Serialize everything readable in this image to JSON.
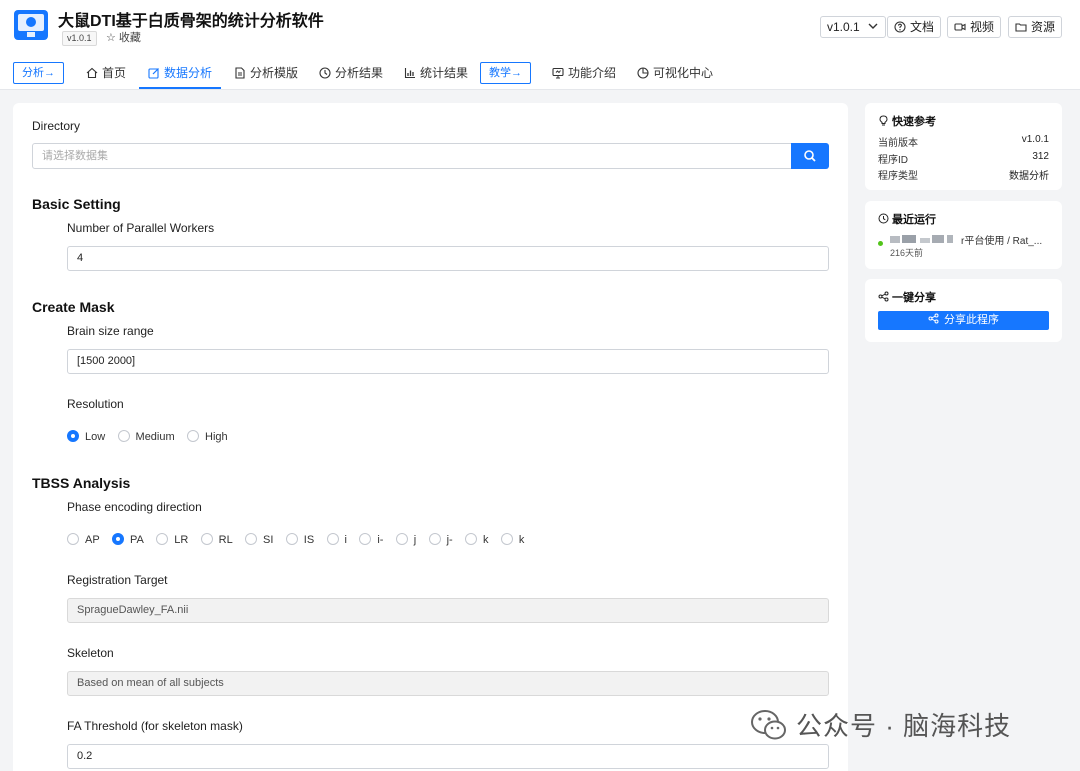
{
  "header": {
    "app_title": "大鼠DTI基于白质骨架的统计分析软件",
    "version_tag": "v1.0.1",
    "favorite_label": "☆ 收藏",
    "version_select": "v1.0.1",
    "docs_label": "文档",
    "video_label": "视频",
    "resources_label": "资源"
  },
  "nav": {
    "analyze_btn": "分析→",
    "home": "首页",
    "data_analysis": "数据分析",
    "analysis_template": "分析模版",
    "analysis_results": "分析结果",
    "stat_results": "统计结果",
    "teaching_btn": "教学→",
    "features": "功能介绍",
    "visual_center": "可视化中心"
  },
  "form": {
    "directory_label": "Directory",
    "directory_placeholder": "请选择数据集",
    "basic_setting_title": "Basic Setting",
    "workers_label": "Number of Parallel Workers",
    "workers_value": "4",
    "create_mask_title": "Create Mask",
    "brain_size_label": "Brain size range",
    "brain_size_value": "[1500 2000]",
    "resolution_label": "Resolution",
    "resolution_options": [
      "Low",
      "Medium",
      "High"
    ],
    "resolution_selected": "Low",
    "tbss_title": "TBSS Analysis",
    "phase_label": "Phase encoding direction",
    "phase_options": [
      "AP",
      "PA",
      "LR",
      "RL",
      "SI",
      "IS",
      "i",
      "i-",
      "j",
      "j-",
      "k",
      "k"
    ],
    "phase_selected": "PA",
    "reg_target_label": "Registration Target",
    "reg_target_value": "SpragueDawley_FA.nii",
    "skeleton_label": "Skeleton",
    "skeleton_value": "Based on mean of all subjects",
    "fa_threshold_label": "FA Threshold (for skeleton mask)",
    "fa_threshold_value": "0.2"
  },
  "quick_ref": {
    "title": "快速参考",
    "rows": [
      {
        "key": "当前版本",
        "value": "v1.0.1"
      },
      {
        "key": "程序ID",
        "value": "312"
      },
      {
        "key": "程序类型",
        "value": "数据分析"
      }
    ]
  },
  "recent_runs": {
    "title": "最近运行",
    "run_text": "r平台使用 / Rat_...",
    "run_time": "216天前"
  },
  "share": {
    "title": "一键分享",
    "button": "分享此程序"
  },
  "watermark": {
    "text": "公众号 · 脑海科技"
  },
  "colors": {
    "primary": "#1677ff",
    "status_dot": "#52c41a"
  }
}
